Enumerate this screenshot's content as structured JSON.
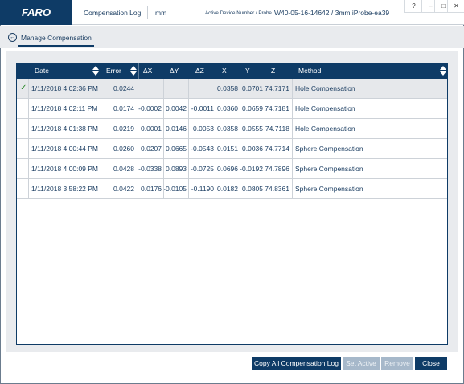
{
  "app": {
    "logo_text": "FARO",
    "title": "Compensation Log",
    "units": "mm",
    "device_label": "Active Device Number / Probe",
    "device_value": "W40-05-16-14642 / 3mm iProbe-ea39"
  },
  "window_controls": {
    "help": "?",
    "minimize": "–",
    "maximize": "□",
    "close": "✕"
  },
  "nav": {
    "back_icon": "back-arrow-icon",
    "title": "Manage Compensation"
  },
  "table": {
    "columns": [
      "Date",
      "Error",
      "ΔX",
      "ΔY",
      "ΔZ",
      "X",
      "Y",
      "Z",
      "Method"
    ],
    "sortable": [
      "Date",
      "Error",
      "Method"
    ],
    "rows": [
      {
        "active": true,
        "date": "1/11/2018 4:02:36 PM",
        "error": "0.0244",
        "dx": "",
        "dy": "",
        "dz": "",
        "x": "0.0358",
        "y": "0.0701",
        "z": "74.7171",
        "method": "Hole Compensation"
      },
      {
        "active": false,
        "date": "1/11/2018 4:02:11 PM",
        "error": "0.0174",
        "dx": "-0.0002",
        "dy": "0.0042",
        "dz": "-0.0011",
        "x": "0.0360",
        "y": "0.0659",
        "z": "74.7181",
        "method": "Hole Compensation"
      },
      {
        "active": false,
        "date": "1/11/2018 4:01:38 PM",
        "error": "0.0219",
        "dx": "0.0001",
        "dy": "0.0146",
        "dz": "0.0053",
        "x": "0.0358",
        "y": "0.0555",
        "z": "74.7118",
        "method": "Hole Compensation"
      },
      {
        "active": false,
        "date": "1/11/2018 4:00:44 PM",
        "error": "0.0260",
        "dx": "0.0207",
        "dy": "0.0665",
        "dz": "-0.0543",
        "x": "0.0151",
        "y": "0.0036",
        "z": "74.7714",
        "method": "Sphere Compensation"
      },
      {
        "active": false,
        "date": "1/11/2018 4:00:09 PM",
        "error": "0.0428",
        "dx": "-0.0338",
        "dy": "0.0893",
        "dz": "-0.0725",
        "x": "0.0696",
        "y": "-0.0192",
        "z": "74.7896",
        "method": "Sphere Compensation"
      },
      {
        "active": false,
        "date": "1/11/2018 3:58:22 PM",
        "error": "0.0422",
        "dx": "0.0176",
        "dy": "-0.0105",
        "dz": "-0.1190",
        "x": "0.0182",
        "y": "0.0805",
        "z": "74.8361",
        "method": "Sphere Compensation"
      }
    ],
    "active_icon": "checkmark-icon",
    "check_color": "#2e8b2e"
  },
  "buttons": {
    "copy_all": "Copy All Compensation Log",
    "set_active": "Set Active",
    "remove": "Remove",
    "close": "Close"
  },
  "colors": {
    "brand": "#0e3b66",
    "text": "#1d3f63",
    "disabled": "#a6b8ca"
  }
}
